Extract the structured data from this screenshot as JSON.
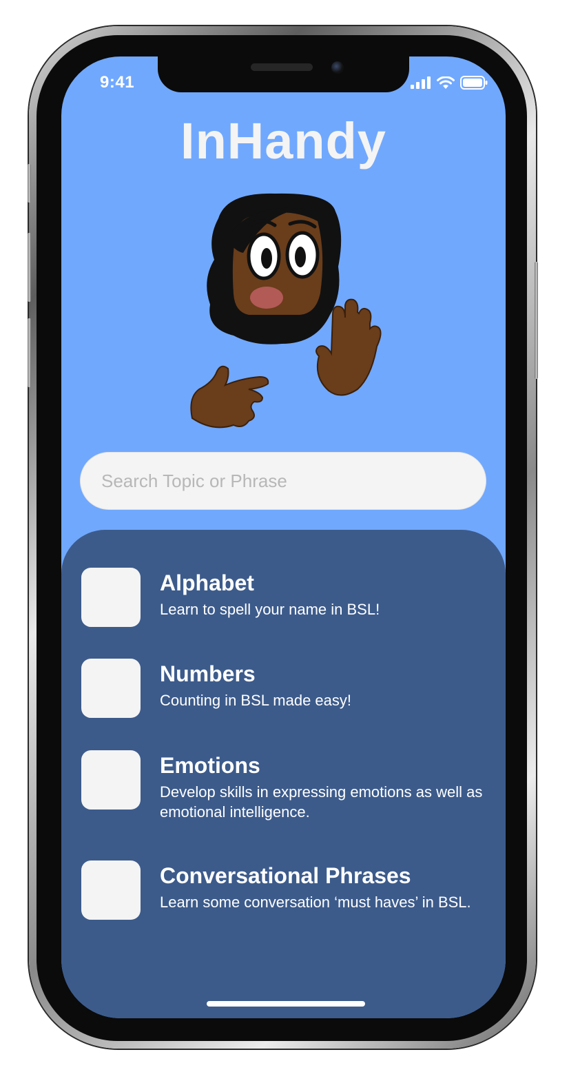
{
  "status_bar": {
    "time": "9:41",
    "icons": [
      "signal-bars-icon",
      "wifi-icon",
      "battery-icon"
    ]
  },
  "app": {
    "title": "InHandy"
  },
  "search": {
    "placeholder": "Search Topic or Phrase",
    "value": ""
  },
  "topics": [
    {
      "title": "Alphabet",
      "description": "Learn to spell your name in BSL!"
    },
    {
      "title": "Numbers",
      "description": "Counting in BSL made easy!"
    },
    {
      "title": "Emotions",
      "description": "Develop skills in expressing emotions as well as emotional intelligence."
    },
    {
      "title": "Conversational Phrases",
      "description": "Learn some conversation ‘must haves’ in BSL."
    }
  ],
  "colors": {
    "screen_background": "#70a8fe",
    "panel_background": "#3c5b8b",
    "thumbnail": "#f4f4f4",
    "title_text": "#f4f4f4"
  }
}
